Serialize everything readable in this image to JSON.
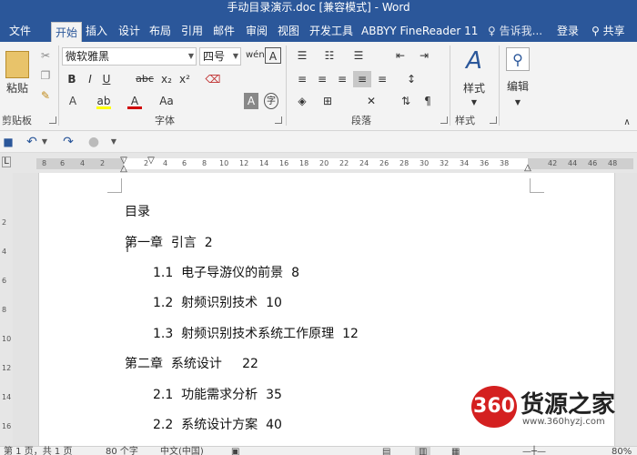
{
  "window": {
    "title": "手动目录演示.doc [兼容模式] - Word"
  },
  "tabs": [
    "文件",
    "开始",
    "插入",
    "设计",
    "布局",
    "引用",
    "邮件",
    "审阅",
    "视图",
    "开发工具",
    "ABBYY FineReader 11"
  ],
  "active_tab": "开始",
  "tell_me": "告诉我...",
  "account": {
    "login": "登录",
    "share": "共享"
  },
  "ribbon": {
    "clipboard": {
      "label": "剪贴板",
      "paste": "粘贴"
    },
    "font": {
      "label": "字体",
      "family": "微软雅黑",
      "size": "四号",
      "bold": "B",
      "italic": "I",
      "underline": "U",
      "strike": "abc",
      "subscript": "x₂",
      "superscript": "x²",
      "clear": "Aa",
      "color_a": "A",
      "change_case": "Aa"
    },
    "paragraph": {
      "label": "段落"
    },
    "styles": {
      "label": "样式",
      "button": "样式"
    },
    "editing": {
      "button": "编辑"
    }
  },
  "ruler_ticks": [
    "8",
    "6",
    "4",
    "2",
    "2",
    "4",
    "6",
    "8",
    "10",
    "12",
    "14",
    "16",
    "18",
    "20",
    "22",
    "24",
    "26",
    "28",
    "30",
    "32",
    "34",
    "36",
    "38",
    "42",
    "44",
    "46",
    "48"
  ],
  "vruler_ticks": [
    "2",
    "4",
    "6",
    "8",
    "10",
    "12",
    "14",
    "16"
  ],
  "document": {
    "toc_title": "目录",
    "entries": [
      {
        "text": "第一章  引言  2",
        "level": 1
      },
      {
        "text": "1.1  电子导游仪的前景  8",
        "level": 2
      },
      {
        "text": "1.2  射频识别技术  10",
        "level": 2
      },
      {
        "text": "1.3  射频识别技术系统工作原理  12",
        "level": 2
      },
      {
        "text": "第二章  系统设计     22",
        "level": 1
      },
      {
        "text": "2.1  功能需求分析  35",
        "level": 2
      },
      {
        "text": "2.2  系统设计方案  40",
        "level": 2
      }
    ]
  },
  "watermark": {
    "logo": "360",
    "name": "货源之家",
    "url": "www.360hyzj.com"
  },
  "status": {
    "page": "第 1 页，共 1 页",
    "words": "80 个字",
    "language": "中文(中国)",
    "zoom": "80%"
  },
  "colors": {
    "accent": "#2b579a",
    "watermark_red": "#d42020"
  }
}
